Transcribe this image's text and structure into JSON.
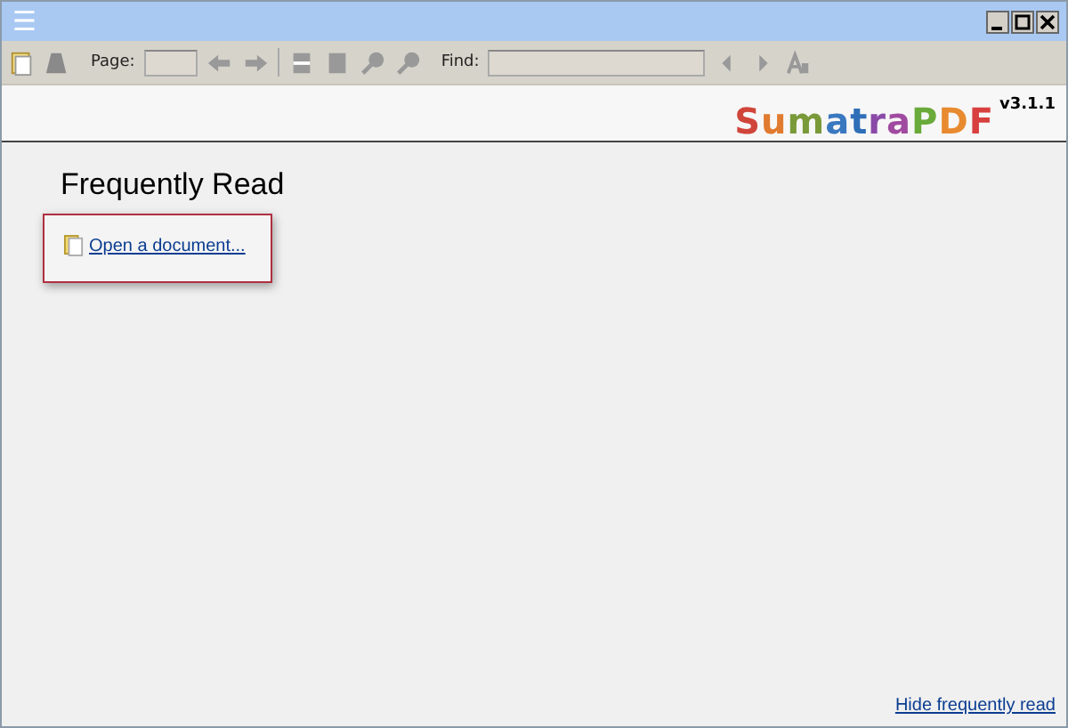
{
  "window": {
    "menu_icon": "☰"
  },
  "toolbar": {
    "page_label": "Page:",
    "find_label": "Find:"
  },
  "logo": {
    "letters": [
      {
        "text": "S",
        "color": "#d0453a"
      },
      {
        "text": "u",
        "color": "#e07b30"
      },
      {
        "text": "m",
        "color": "#7a9a3a"
      },
      {
        "text": "a",
        "color": "#3a78c0"
      },
      {
        "text": "t",
        "color": "#2f6fb8"
      },
      {
        "text": "r",
        "color": "#8a4aa8"
      },
      {
        "text": "a",
        "color": "#a04aa0"
      },
      {
        "text": "P",
        "color": "#6aaa3a"
      },
      {
        "text": "D",
        "color": "#e88a30"
      },
      {
        "text": "F",
        "color": "#d84040"
      }
    ],
    "version": "v3.1.1"
  },
  "heading": "Frequently Read",
  "documents": [
    {
      "label": "Open a document..."
    }
  ],
  "hide_link": "Hide frequently read"
}
